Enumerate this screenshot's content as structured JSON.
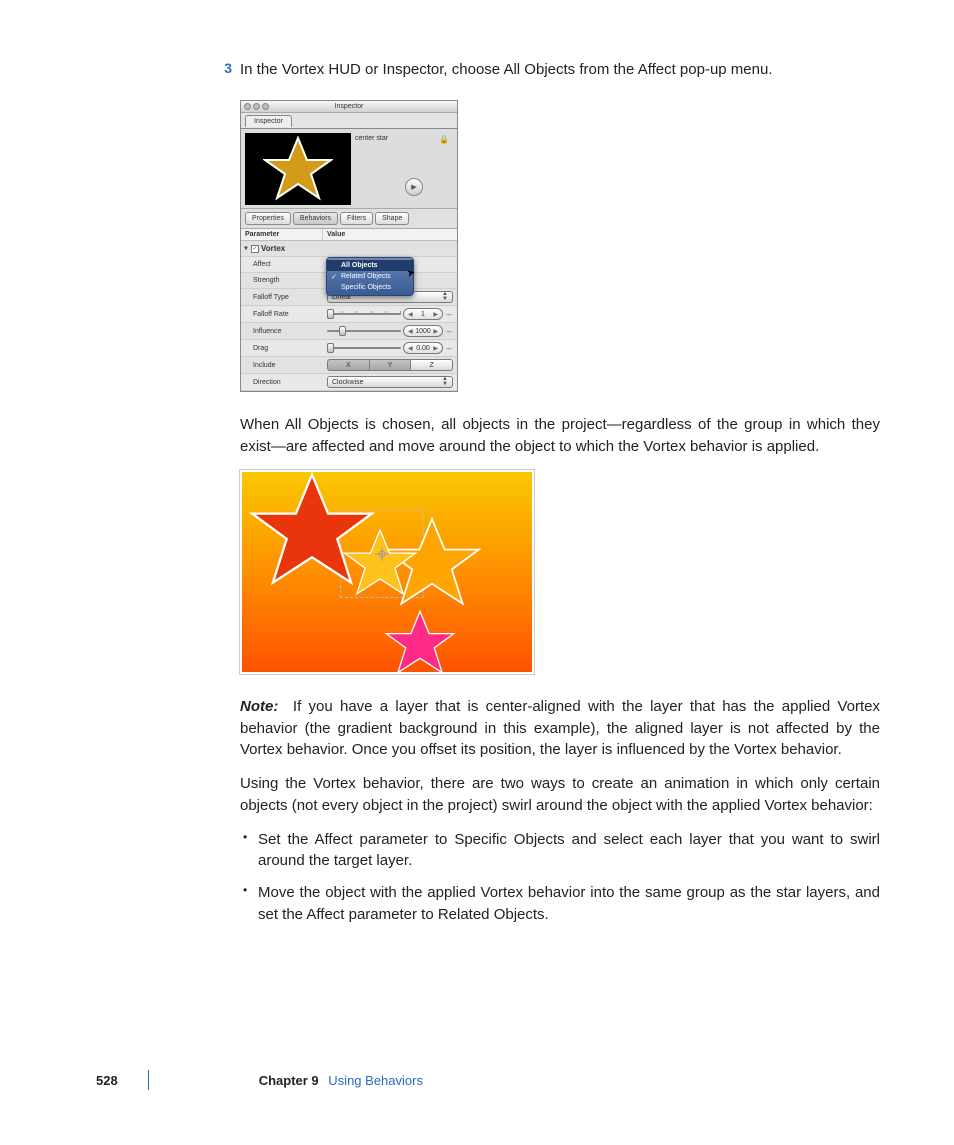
{
  "step": {
    "number": "3",
    "text": "In the Vortex HUD or Inspector, choose All Objects from the Affect pop-up menu."
  },
  "inspector": {
    "window_title": "Inspector",
    "tab": "Inspector",
    "object_name": "center star",
    "mini_tabs": [
      "Properties",
      "Behaviors",
      "Filters",
      "Shape"
    ],
    "header_param": "Parameter",
    "header_value": "Value",
    "behavior_name": "Vortex",
    "params": {
      "affect": "Affect",
      "strength": "Strength",
      "falloff_type": "Falloff Type",
      "falloff_rate_label": "Falloff Rate",
      "falloff_rate": "1",
      "influence_label": "Influence",
      "influence": "1000",
      "drag_label": "Drag",
      "drag": "0.00",
      "include": "Include",
      "axes": [
        "X",
        "Y",
        "Z"
      ],
      "direction_label": "Direction",
      "direction": "Clockwise",
      "linear": "Linear"
    },
    "menu": {
      "all_objects": "All Objects",
      "related": "Related Objects",
      "specific": "Specific Objects"
    }
  },
  "para1": "When All Objects is chosen, all objects in the project—regardless of the group in which they exist—are affected and move around the object to which the Vortex behavior is applied.",
  "note_label": "Note:",
  "note_text": "If you have a layer that is center-aligned with the layer that has the applied Vortex behavior (the gradient background in this example), the aligned layer is not affected by the Vortex behavior. Once you offset its position, the layer is influenced by the Vortex behavior.",
  "para2": "Using the Vortex behavior, there are two ways to create an animation in which only certain objects (not every object in the project) swirl around the object with the applied Vortex behavior:",
  "bullets": [
    "Set the Affect parameter to Specific Objects and select each layer that you want to swirl around the target layer.",
    "Move the object with the applied Vortex behavior into the same group as the star layers, and set the Affect parameter to Related Objects."
  ],
  "footer": {
    "page": "528",
    "chapter": "Chapter 9",
    "title": "Using Behaviors"
  }
}
